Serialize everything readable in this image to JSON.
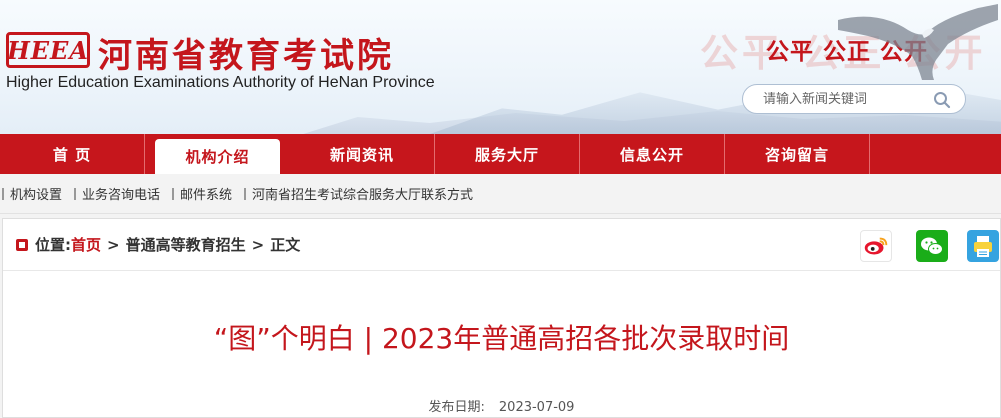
{
  "header": {
    "logo_text": "HEEA",
    "site_name": "河南省教育考试院",
    "site_name_en": "Higher Education Examinations Authority of HeNan Province",
    "slogan": "公平 公正 公开",
    "slogan_ghost": "公平 公正 公开",
    "search_placeholder": "请输入新闻关键词",
    "search_icon": "search-icon"
  },
  "nav": {
    "items": [
      {
        "label": "首 页"
      },
      {
        "label": "机构介绍",
        "active": true
      },
      {
        "label": "新闻资讯"
      },
      {
        "label": "服务大厅"
      },
      {
        "label": "信息公开"
      },
      {
        "label": "咨询留言"
      }
    ]
  },
  "sublinks": [
    "机构设置",
    "业务咨询电话",
    "邮件系统",
    "河南省招生考试综合服务大厅联系方式"
  ],
  "breadcrumb": {
    "label": "位置:",
    "home": "首页",
    "sep": ">",
    "section": "普通高等教育招生",
    "current": "正文"
  },
  "share": {
    "icons": [
      "weibo-icon",
      "wechat-icon",
      "print-icon"
    ]
  },
  "article": {
    "title": "“图”个明白 | 2023年普通高招各批次录取时间",
    "date_label": "发布日期:",
    "date": "2023-07-09"
  },
  "colors": {
    "brand_red": "#c4161c",
    "nav_red": "#c6161c",
    "wechat_green": "#1aad19",
    "print_blue": "#35a3e0"
  }
}
